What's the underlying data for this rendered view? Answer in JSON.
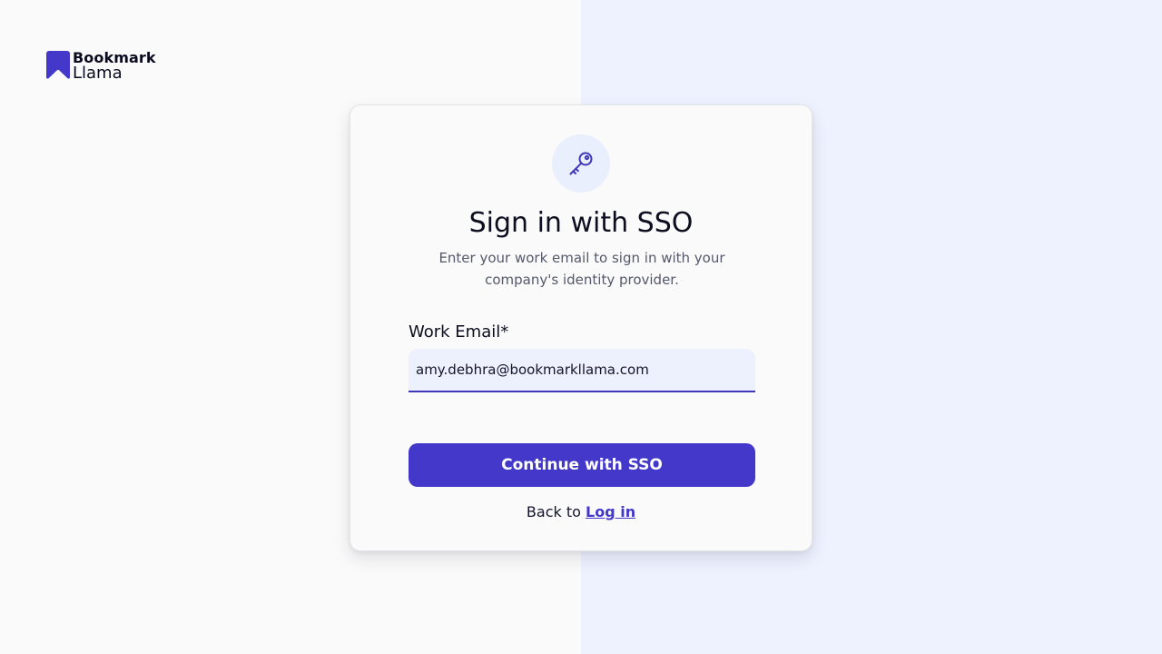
{
  "brand": {
    "name_line1": "Bookmark",
    "name_line2": "Llama",
    "logo_icon": "bookmark-icon",
    "accent_color": "#4338ca"
  },
  "card": {
    "icon": "key-icon",
    "title": "Sign in with SSO",
    "subtitle": "Enter your work email to sign in with your company's identity provider.",
    "email_label": "Work Email*",
    "email_value": "amy.debhra@bookmarkllama.com",
    "submit_label": "Continue with SSO",
    "back_prefix": "Back to",
    "back_link": "Log in"
  }
}
